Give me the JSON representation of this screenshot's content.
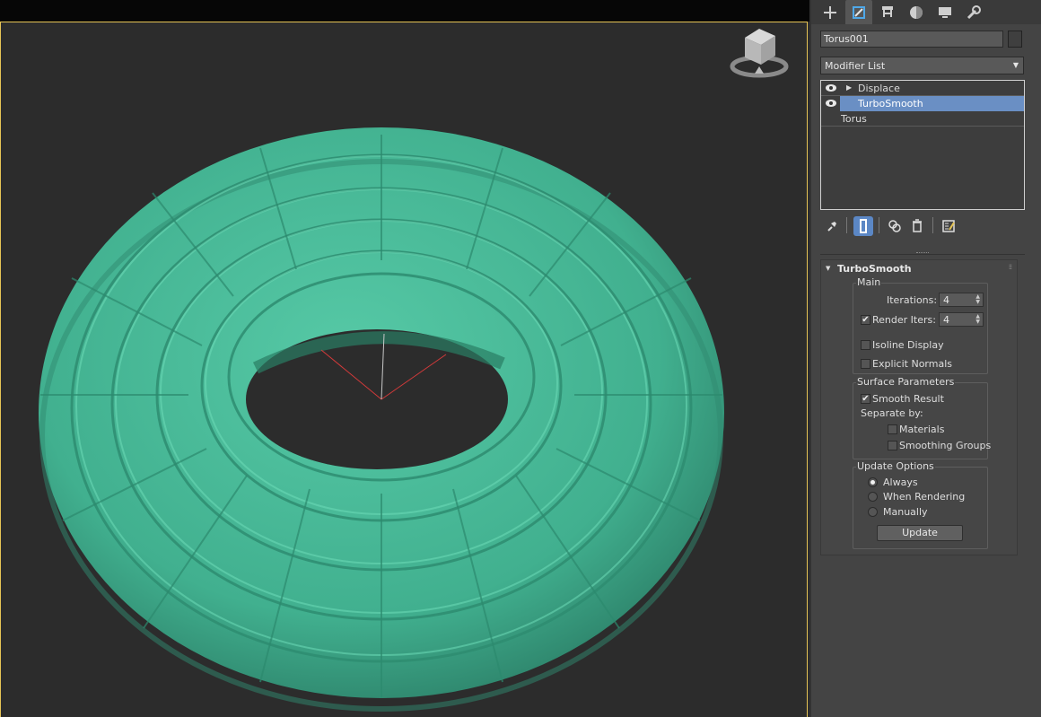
{
  "object_name": "Torus001",
  "modifier_list_label": "Modifier List",
  "stack": [
    {
      "label": "Displace"
    },
    {
      "label": "TurboSmooth"
    },
    {
      "label": "Torus"
    }
  ],
  "rollout": {
    "title": "TurboSmooth",
    "main": {
      "title": "Main",
      "iterations_label": "Iterations:",
      "iterations_value": "4",
      "render_iters_label": "Render Iters:",
      "render_iters_value": "4",
      "isoline_label": "Isoline Display",
      "explicit_normals_label": "Explicit Normals"
    },
    "surface": {
      "title": "Surface Parameters",
      "smooth_result_label": "Smooth Result",
      "separate_by_label": "Separate by:",
      "materials_label": "Materials",
      "smoothing_groups_label": "Smoothing Groups"
    },
    "update": {
      "title": "Update Options",
      "always_label": "Always",
      "when_rendering_label": "When Rendering",
      "manually_label": "Manually",
      "button_label": "Update"
    }
  },
  "colors": {
    "torus": "#3fae8e",
    "selection": "#6a8fc4",
    "viewport_bg": "#2c2c2c",
    "active_border": "#e6c455",
    "highlight_underline": "#e00000"
  },
  "icons": [
    "create-icon",
    "modify-icon",
    "hierarchy-icon",
    "motion-icon",
    "display-icon",
    "utilities-icon",
    "pin-icon",
    "show-end-result-icon",
    "make-unique-icon",
    "remove-modifier-icon",
    "configure-sets-icon",
    "eye-icon",
    "viewcube-icon"
  ]
}
